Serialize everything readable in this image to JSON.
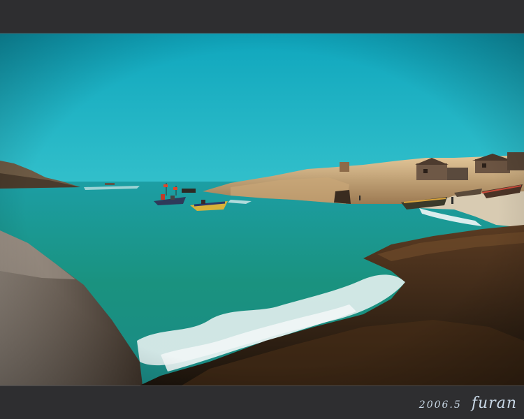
{
  "photo": {
    "subject": "coastal-cove-with-fishing-boats",
    "colors": {
      "sky_top": "#12a9bc",
      "sky_bottom": "#2ebdc9",
      "sea_far": "#1a9c9e",
      "sea_near": "#1e8f86",
      "rock_dark": "#3a2a1a",
      "rock_light": "#d9b98a",
      "foam": "#f2f6f7",
      "frame": "#2e2e30"
    }
  },
  "signature": {
    "date": "2006.5",
    "name": "furan"
  }
}
